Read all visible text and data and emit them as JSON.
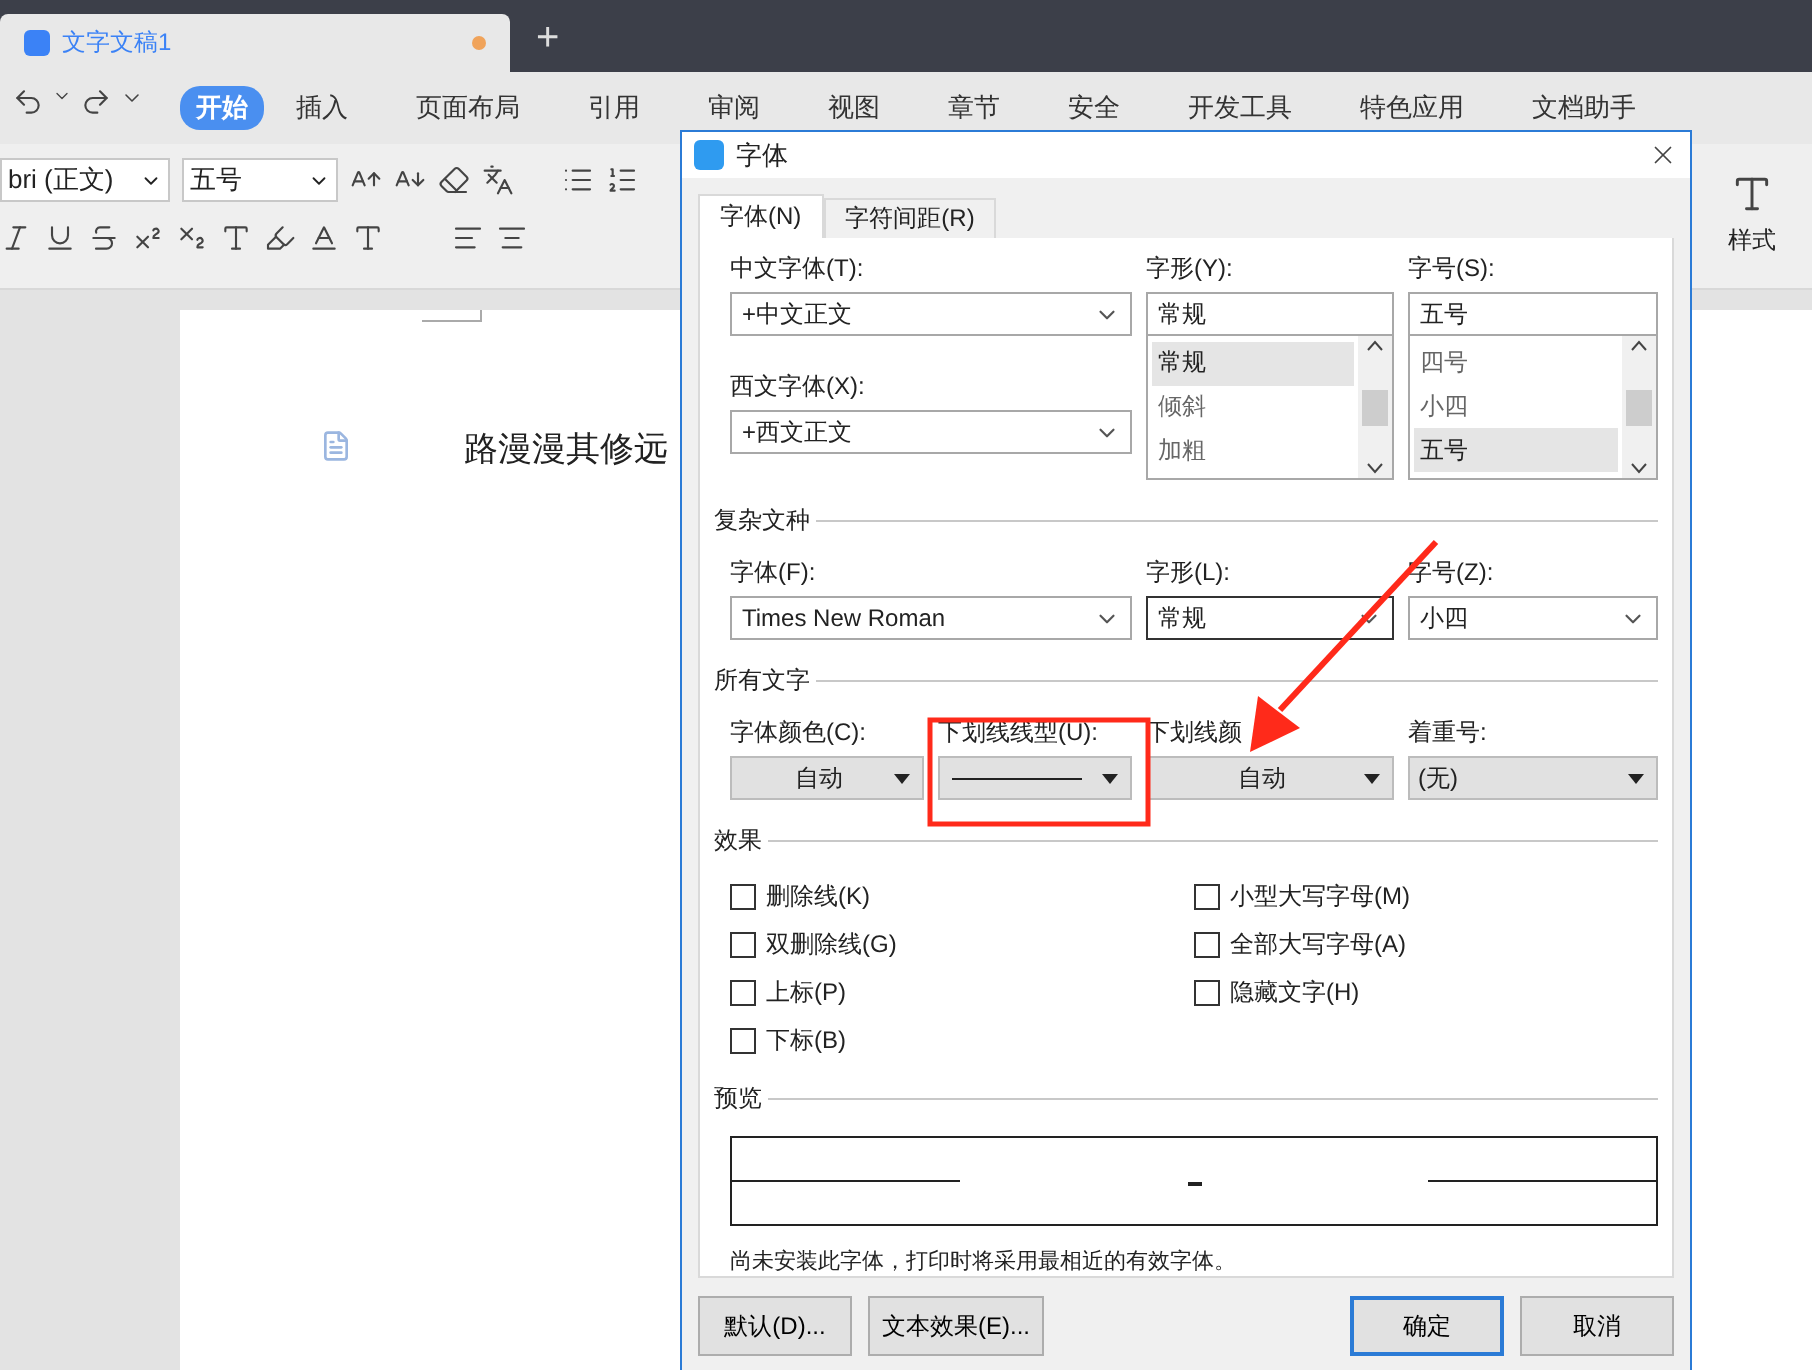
{
  "app_tab": {
    "title": "文字文稿1",
    "modified": true
  },
  "new_tab": "+",
  "menu": [
    {
      "label": "开始",
      "selected": true
    },
    {
      "label": "插入",
      "selected": false
    },
    {
      "label": "页面布局",
      "selected": false
    },
    {
      "label": "引用",
      "selected": false
    },
    {
      "label": "审阅",
      "selected": false
    },
    {
      "label": "视图",
      "selected": false
    },
    {
      "label": "章节",
      "selected": false
    },
    {
      "label": "安全",
      "selected": false
    },
    {
      "label": "开发工具",
      "selected": false
    },
    {
      "label": "特色应用",
      "selected": false
    },
    {
      "label": "文档助手",
      "selected": false
    }
  ],
  "toolbar": {
    "font": "bri (正文)",
    "size": "五号",
    "styles_label": "样式"
  },
  "document": {
    "text": "路漫漫其修远"
  },
  "dialog": {
    "title": "字体",
    "tabs": [
      {
        "label": "字体(N)",
        "selected": true
      },
      {
        "label": "字符间距(R)",
        "selected": false
      }
    ],
    "chinese_font": {
      "label": "中文字体(T):",
      "value": "+中文正文"
    },
    "western_font": {
      "label": "西文字体(X):",
      "value": "+西文正文"
    },
    "style": {
      "label": "字形(Y):",
      "value": "常规",
      "options": [
        {
          "label": "常规",
          "selected": true
        },
        {
          "label": "倾斜",
          "selected": false
        },
        {
          "label": "加粗",
          "selected": false
        }
      ]
    },
    "size": {
      "label": "字号(S):",
      "value": "五号",
      "options": [
        {
          "label": "四号",
          "selected": false
        },
        {
          "label": "小四",
          "selected": false
        },
        {
          "label": "五号",
          "selected": true
        }
      ]
    },
    "complex_section": "复杂文种",
    "complex_font": {
      "label": "字体(F):",
      "value": "Times New Roman"
    },
    "complex_style": {
      "label": "字形(L):",
      "value": "常规"
    },
    "complex_size": {
      "label": "字号(Z):",
      "value": "小四"
    },
    "all_text_section": "所有文字",
    "font_color": {
      "label": "字体颜色(C):",
      "value": "自动"
    },
    "underline_type": {
      "label": "下划线线型(U):",
      "underlined": true
    },
    "underline_color": {
      "label": "下划线颜",
      "value": "自动"
    },
    "emphasis": {
      "label": "着重号:",
      "value": "(无)"
    },
    "effects_section": "效果",
    "effects": [
      {
        "label": "删除线(K)",
        "checked": false
      },
      {
        "label": "小型大写字母(M)",
        "checked": false
      },
      {
        "label": "双删除线(G)",
        "checked": false
      },
      {
        "label": "全部大写字母(A)",
        "checked": false
      },
      {
        "label": "上标(P)",
        "checked": false
      },
      {
        "label": "隐藏文字(H)",
        "checked": false
      },
      {
        "label": "下标(B)",
        "checked": false
      }
    ],
    "preview_section": "预览",
    "note": "尚未安装此字体，打印时将采用最相近的有效字体。",
    "buttons": [
      {
        "label": "默认(D)...",
        "default": false
      },
      {
        "label": "文本效果(E)...",
        "default": false
      },
      {
        "label": "确定",
        "default": true
      },
      {
        "label": "取消",
        "default": false
      }
    ]
  },
  "annotations": {
    "highlight_box": true,
    "arrow": true
  }
}
